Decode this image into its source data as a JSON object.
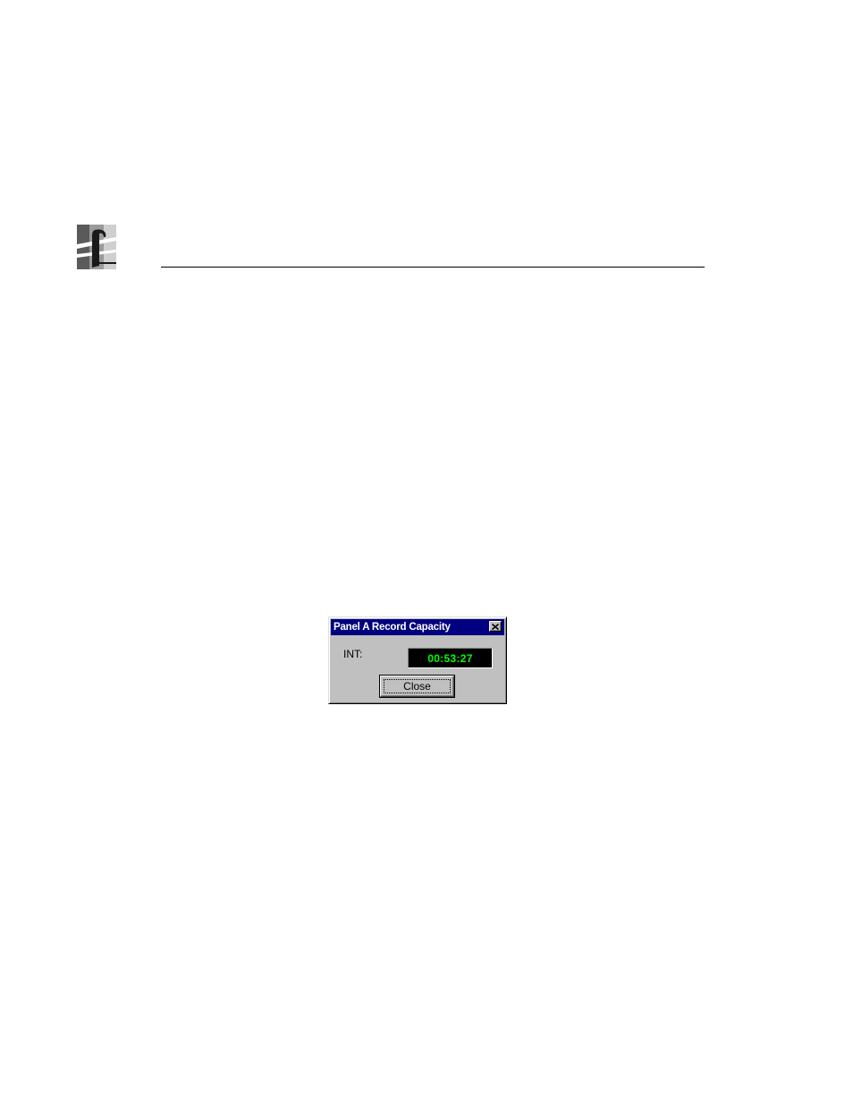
{
  "page": {
    "background_color": "#ffffff",
    "logo_icon": "grass-valley-logo-icon"
  },
  "dialog": {
    "title": "Panel A Record Capacity",
    "titlebar_color": "#000080",
    "close_icon": "close-icon",
    "int_label": "INT:",
    "timecode": "00:53:27",
    "timecode_color": "#00ff00",
    "close_button_label": "Close"
  }
}
